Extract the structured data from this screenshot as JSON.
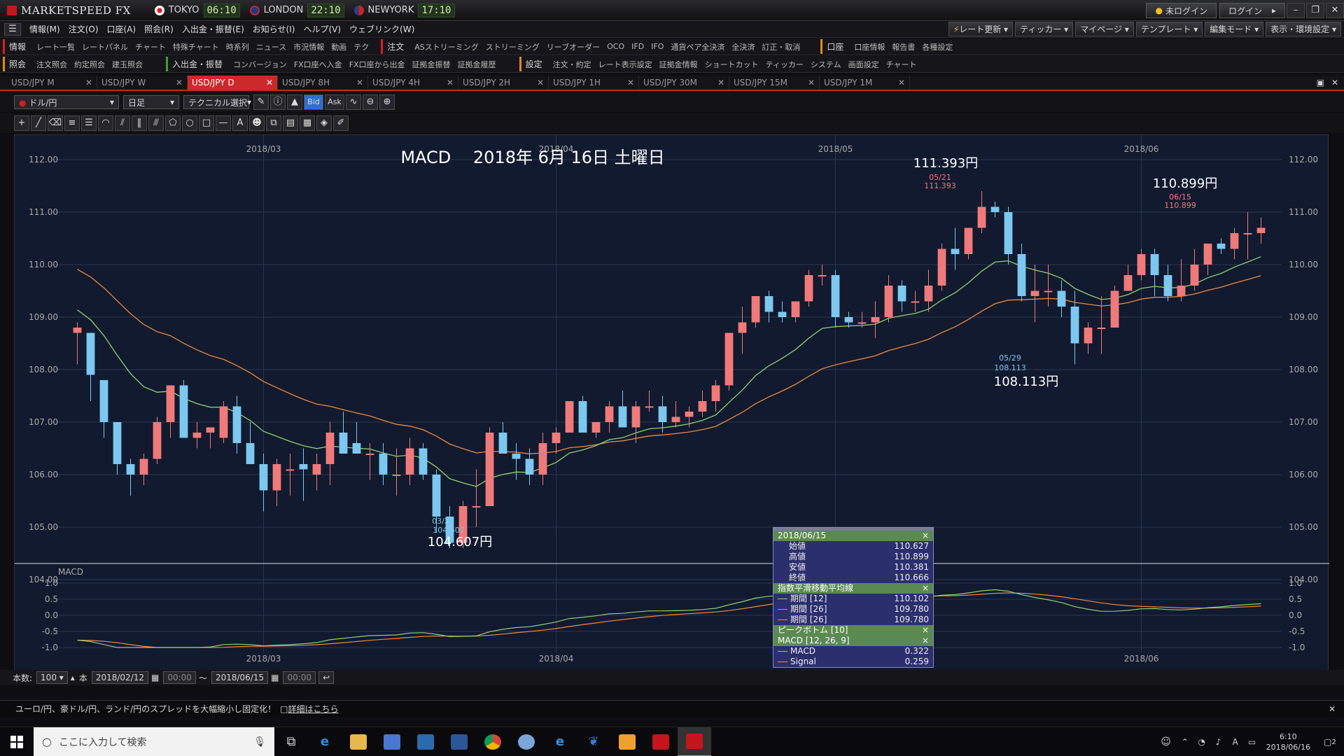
{
  "titlebar": {
    "app_name": "MARKETSPEED FX",
    "clocks": [
      {
        "city": "TOKYO",
        "time": "06:10",
        "flag_color": "#ffffff"
      },
      {
        "city": "LONDON",
        "time": "22:10",
        "flag_color": "#1a3b8a"
      },
      {
        "city": "NEWYORK",
        "time": "17:10",
        "flag_color": "#2a3f8a"
      }
    ],
    "login_status": "未ログイン",
    "login_button": "ログイン"
  },
  "menubar": {
    "items": [
      "情報(M)",
      "注文(O)",
      "口座(A)",
      "照会(R)",
      "入出金・振替(E)",
      "お知らせ(I)",
      "ヘルプ(V)",
      "ウェブリンク(W)"
    ],
    "right_tools": [
      "レート更新",
      "ティッカー",
      "マイページ",
      "テンプレート",
      "編集モード",
      "表示・環境設定"
    ]
  },
  "toolbar1": {
    "info_tag": "情報",
    "info_items": [
      "レート一覧",
      "レートパネル",
      "チャート",
      "特殊チャート",
      "時系列",
      "ニュース",
      "市況情報",
      "動画",
      "テク"
    ],
    "order_tag": "注文",
    "order_items": [
      "ASストリーミング",
      "ストリーミング",
      "リーブオーダー",
      "OCO",
      "IFD",
      "IFO",
      "通貨ペア全決済",
      "全決済",
      "訂正・取消"
    ],
    "account_tag": "口座",
    "account_items": [
      "口座情報",
      "報告書",
      "各種設定"
    ]
  },
  "toolbar2": {
    "inquiry_tag": "照会",
    "inquiry_items": [
      "注文照会",
      "約定照会",
      "建玉照会"
    ],
    "transfer_tag": "入出金・振替",
    "transfer_items": [
      "コンバージョン",
      "FX口座へ入金",
      "FX口座から出金",
      "証拠金振替",
      "証拠金履歴"
    ],
    "settings_tag": "設定",
    "settings_items": [
      "注文・約定",
      "レート表示設定",
      "証拠金情報",
      "ショートカット",
      "ティッカー",
      "システム",
      "画面設定",
      "チャート"
    ]
  },
  "tabs": [
    {
      "label": "USD/JPY M",
      "active": false
    },
    {
      "label": "USD/JPY W",
      "active": false
    },
    {
      "label": "USD/JPY D",
      "active": true
    },
    {
      "label": "USD/JPY 8H",
      "active": false
    },
    {
      "label": "USD/JPY 4H",
      "active": false
    },
    {
      "label": "USD/JPY 2H",
      "active": false
    },
    {
      "label": "USD/JPY 1H",
      "active": false
    },
    {
      "label": "USD/JPY 30M",
      "active": false
    },
    {
      "label": "USD/JPY 15M",
      "active": false
    },
    {
      "label": "USD/JPY 1M",
      "active": false
    }
  ],
  "chart_toolbar": {
    "pair_select": "ドル/円",
    "period_select": "日足",
    "technical_select": "テクニカル選択",
    "bid_label": "Bid",
    "ask_label": "Ask"
  },
  "chart_annotation": {
    "title_overlay": "MACD　 2018年 6月 16日 土曜日",
    "high_label": "111.393円",
    "high_date": "05/21",
    "high_value": "111.393",
    "low_label": "108.113円",
    "low_date": "05/29",
    "low_value": "108.113",
    "low2_label": "104.607円",
    "low2_date": "03/26",
    "low2_value": "104.607",
    "last_label": "110.899円",
    "last_date": "06/15",
    "last_value": "110.899"
  },
  "chart_data": {
    "type": "candlestick",
    "pair": "USD/JPY",
    "timeframe": "Daily",
    "date_range": [
      "2018/02/12",
      "2018/06/15"
    ],
    "ylim": [
      104.0,
      112.0
    ],
    "yticks": [
      "112.00",
      "111.00",
      "110.00",
      "109.00",
      "108.00",
      "107.00",
      "106.00",
      "105.00",
      "104.00"
    ],
    "month_labels": [
      {
        "label": "2018/03",
        "index": 14
      },
      {
        "label": "2018/04",
        "index": 36
      },
      {
        "label": "2018/05",
        "index": 57
      },
      {
        "label": "2018/06",
        "index": 80
      }
    ],
    "ohlc": [
      [
        108.7,
        108.9,
        108.1,
        108.8
      ],
      [
        108.7,
        108.7,
        107.4,
        107.9
      ],
      [
        107.8,
        107.8,
        106.7,
        107.0
      ],
      [
        107.0,
        107.0,
        106.0,
        106.2
      ],
      [
        106.2,
        106.3,
        105.6,
        106.0
      ],
      [
        106.0,
        106.4,
        105.8,
        106.3
      ],
      [
        106.3,
        107.1,
        106.2,
        107.0
      ],
      [
        107.0,
        107.6,
        106.7,
        107.7
      ],
      [
        107.7,
        107.8,
        106.7,
        106.7
      ],
      [
        106.7,
        107.0,
        106.5,
        106.8
      ],
      [
        106.8,
        106.9,
        106.5,
        106.9
      ],
      [
        106.7,
        107.4,
        106.6,
        107.3
      ],
      [
        107.3,
        107.5,
        106.4,
        106.6
      ],
      [
        106.6,
        107.0,
        106.2,
        106.2
      ],
      [
        106.2,
        106.4,
        105.3,
        105.7
      ],
      [
        105.7,
        106.3,
        105.4,
        106.2
      ],
      [
        106.1,
        106.4,
        105.6,
        106.1
      ],
      [
        106.2,
        106.5,
        105.5,
        106.1
      ],
      [
        106.0,
        106.4,
        105.7,
        106.2
      ],
      [
        106.2,
        107.0,
        105.8,
        106.8
      ],
      [
        106.8,
        107.2,
        106.4,
        106.4
      ],
      [
        106.6,
        107.0,
        106.4,
        106.4
      ],
      [
        106.4,
        106.6,
        105.9,
        106.4
      ],
      [
        106.4,
        106.6,
        105.8,
        106.0
      ],
      [
        106.0,
        106.5,
        105.6,
        106.0
      ],
      [
        106.0,
        106.7,
        105.8,
        106.5
      ],
      [
        106.5,
        106.6,
        105.9,
        106.0
      ],
      [
        106.0,
        106.1,
        104.9,
        105.2
      ],
      [
        105.2,
        105.4,
        104.6,
        104.7
      ],
      [
        104.7,
        105.5,
        104.6,
        105.4
      ],
      [
        105.4,
        106.1,
        105.0,
        105.4
      ],
      [
        105.4,
        106.9,
        105.4,
        106.8
      ],
      [
        106.8,
        107.0,
        106.4,
        106.4
      ],
      [
        106.4,
        106.6,
        105.9,
        106.3
      ],
      [
        106.3,
        106.5,
        105.8,
        106.0
      ],
      [
        106.0,
        106.8,
        105.8,
        106.6
      ],
      [
        106.6,
        106.9,
        106.4,
        106.8
      ],
      [
        106.8,
        107.4,
        106.8,
        107.4
      ],
      [
        107.4,
        107.5,
        106.8,
        106.8
      ],
      [
        106.8,
        107.0,
        106.7,
        107.0
      ],
      [
        107.0,
        107.4,
        106.8,
        107.3
      ],
      [
        107.3,
        107.6,
        106.9,
        106.9
      ],
      [
        106.9,
        107.4,
        106.6,
        107.3
      ],
      [
        107.3,
        107.6,
        107.2,
        107.3
      ],
      [
        107.3,
        107.5,
        106.8,
        107.0
      ],
      [
        107.0,
        107.4,
        106.9,
        107.1
      ],
      [
        107.1,
        107.3,
        106.9,
        107.2
      ],
      [
        107.2,
        107.6,
        107.1,
        107.4
      ],
      [
        107.4,
        107.8,
        107.2,
        107.7
      ],
      [
        107.7,
        108.7,
        107.6,
        108.7
      ],
      [
        108.7,
        109.2,
        108.3,
        108.9
      ],
      [
        108.9,
        109.4,
        108.8,
        109.4
      ],
      [
        109.4,
        109.5,
        108.9,
        109.1
      ],
      [
        109.1,
        109.3,
        108.9,
        109.0
      ],
      [
        109.0,
        109.3,
        108.9,
        109.3
      ],
      [
        109.3,
        109.9,
        109.2,
        109.8
      ],
      [
        109.8,
        110.0,
        109.6,
        109.8
      ],
      [
        109.8,
        109.9,
        108.8,
        109.0
      ],
      [
        109.0,
        109.1,
        108.8,
        108.9
      ],
      [
        108.9,
        109.1,
        108.8,
        108.9
      ],
      [
        108.9,
        109.3,
        108.6,
        109.0
      ],
      [
        109.0,
        109.8,
        108.9,
        109.6
      ],
      [
        109.6,
        109.7,
        109.1,
        109.3
      ],
      [
        109.3,
        109.5,
        109.1,
        109.3
      ],
      [
        109.3,
        109.9,
        109.1,
        109.6
      ],
      [
        109.6,
        110.4,
        109.5,
        110.3
      ],
      [
        110.3,
        110.7,
        109.9,
        110.2
      ],
      [
        110.2,
        110.7,
        110.1,
        110.7
      ],
      [
        110.7,
        111.4,
        110.6,
        111.1
      ],
      [
        111.1,
        111.2,
        110.9,
        111.0
      ],
      [
        111.0,
        111.1,
        110.0,
        110.2
      ],
      [
        110.2,
        110.4,
        109.3,
        109.4
      ],
      [
        109.4,
        110.0,
        108.9,
        109.5
      ],
      [
        109.5,
        110.0,
        109.2,
        109.5
      ],
      [
        109.5,
        109.7,
        109.0,
        109.2
      ],
      [
        109.2,
        109.5,
        108.1,
        108.5
      ],
      [
        108.5,
        108.9,
        108.3,
        108.8
      ],
      [
        108.8,
        109.4,
        108.3,
        108.8
      ],
      [
        108.8,
        109.6,
        108.8,
        109.5
      ],
      [
        109.5,
        110.0,
        109.5,
        109.8
      ],
      [
        109.8,
        110.3,
        109.7,
        110.2
      ],
      [
        110.2,
        110.3,
        109.4,
        109.8
      ],
      [
        109.8,
        110.0,
        109.3,
        109.4
      ],
      [
        109.4,
        110.1,
        109.3,
        109.6
      ],
      [
        109.6,
        110.3,
        109.5,
        110.0
      ],
      [
        110.0,
        110.4,
        109.8,
        110.4
      ],
      [
        110.4,
        110.5,
        110.2,
        110.3
      ],
      [
        110.3,
        110.7,
        110.1,
        110.6
      ],
      [
        110.6,
        111.0,
        110.1,
        110.6
      ],
      [
        110.6,
        110.9,
        110.4,
        110.7
      ]
    ],
    "ema_short_color": "#8fd16f",
    "ema_long_color": "#f08a3a",
    "bull_color": "#f07a7a",
    "bear_color": "#7cc8f0",
    "macd": {
      "label": "MACD",
      "ylim": [
        -1.0,
        1.0
      ],
      "yticks": [
        "1.0",
        "0.5",
        "0.0",
        "-0.5",
        "-1.0"
      ],
      "macd_color": "#8fd16f",
      "signal_color": "#f08a3a"
    }
  },
  "info_panel": {
    "date": "2018/06/15",
    "ohlc": [
      {
        "k": "始値",
        "v": "110.627"
      },
      {
        "k": "高値",
        "v": "110.899"
      },
      {
        "k": "安値",
        "v": "110.381"
      },
      {
        "k": "終値",
        "v": "110.666"
      }
    ],
    "ema_header": "指数平滑移動平均線",
    "ema": [
      {
        "k": "期間 [12]",
        "v": "110.102",
        "color": "#8fd16f"
      },
      {
        "k": "期間 [26]",
        "v": "109.780",
        "color": "#f08a3a"
      },
      {
        "k": "期間 [26]",
        "v": "109.780",
        "color": "#f08a3a"
      }
    ],
    "peak_header": "ピークボトム [10]",
    "macd_header": "MACD [12, 26, 9]",
    "macd": [
      {
        "k": "MACD",
        "v": "0.322",
        "color": "#8fd16f"
      },
      {
        "k": "Signal",
        "v": "0.259",
        "color": "#f08a3a"
      }
    ]
  },
  "rangebar": {
    "count_label": "本数:",
    "count_value": "100",
    "unit": "本",
    "start_date": "2018/02/12",
    "start_time": "00:00",
    "tilde": "～",
    "end_date": "2018/06/15",
    "end_time": "00:00"
  },
  "news": {
    "text": "ユーロ/円、豪ドル/円、ランド/円のスプレッドを大幅縮小し固定化！",
    "link": "詳細はこちら"
  },
  "taskbar": {
    "search_placeholder": "ここに入力して検索",
    "time": "6:10",
    "date": "2018/06/16",
    "notif_count": "2"
  }
}
